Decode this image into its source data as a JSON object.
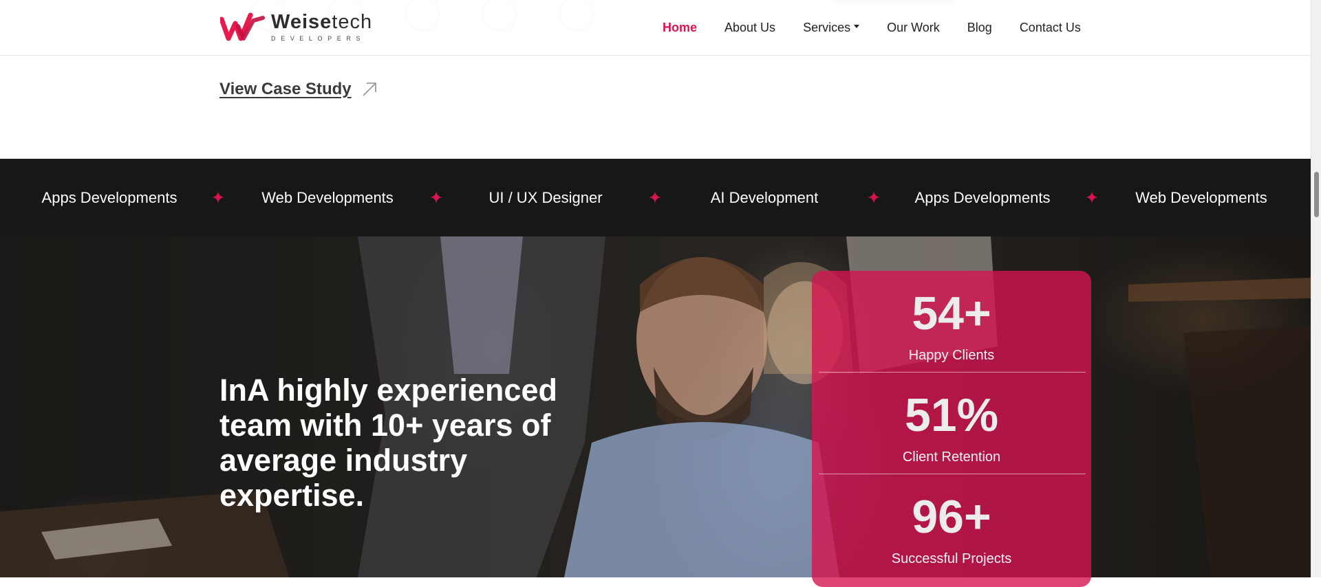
{
  "colors": {
    "accent": "#d7144d",
    "ticker_bg": "#171717",
    "stats_bg": "#d41450"
  },
  "header": {
    "logo": {
      "name_bold": "Weise",
      "name_regular": "tech",
      "sub": "DEVELOPERS",
      "icon": "weisetech-logo-icon"
    },
    "nav": [
      {
        "label": "Home",
        "active": true
      },
      {
        "label": "About Us"
      },
      {
        "label": "Services",
        "dropdown": true
      },
      {
        "label": "Our Work"
      },
      {
        "label": "Blog"
      },
      {
        "label": "Contact Us"
      }
    ]
  },
  "case_study": {
    "label": "View Case Study",
    "icon": "arrow-up-right-icon"
  },
  "ticker": {
    "items": [
      "Apps Developments",
      "Web Developments",
      "UI / UX Designer",
      "AI Development",
      "Apps Developments",
      "Web Developments"
    ],
    "separator_icon": "star-icon"
  },
  "hero": {
    "heading": "InA highly experienced team with 10+ years of average industry expertise."
  },
  "stats": [
    {
      "value": "54+",
      "label": "Happy Clients"
    },
    {
      "value": "51%",
      "label": "Client Retention"
    },
    {
      "value": "96+",
      "label": "Successful Projects"
    }
  ]
}
